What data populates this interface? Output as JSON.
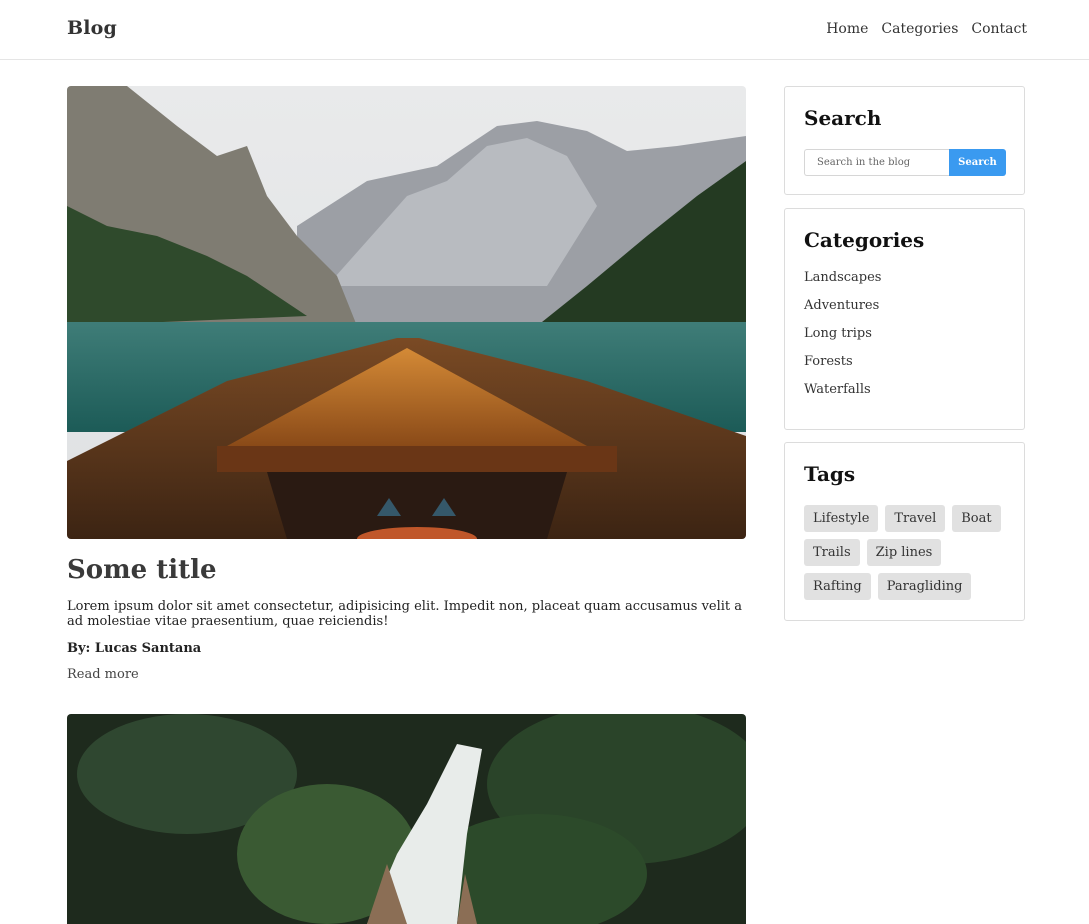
{
  "header": {
    "brand": "Blog",
    "nav": [
      "Home",
      "Categories",
      "Contact"
    ]
  },
  "post": {
    "title": "Some title",
    "excerpt": "Lorem ipsum dolor sit amet consectetur, adipisicing elit. Impedit non, placeat quam accusamus velit a ad molestiae vitae praesentium, quae reiciendis!",
    "author": "By: Lucas Santana",
    "read_more": "Read more"
  },
  "sidebar": {
    "search": {
      "title": "Search",
      "placeholder": "Search in the blog",
      "button": "Search"
    },
    "categories": {
      "title": "Categories",
      "items": [
        "Landscapes",
        "Adventures",
        "Long trips",
        "Forests",
        "Waterfalls"
      ]
    },
    "tags": {
      "title": "Tags",
      "items": [
        "Lifestyle",
        "Travel",
        "Boat",
        "Trails",
        "Zip lines",
        "Rafting",
        "Paragliding"
      ]
    }
  },
  "colors": {
    "accent": "#3a9af0",
    "tag_bg": "#e1e1e1",
    "border": "#dcdcdc"
  }
}
